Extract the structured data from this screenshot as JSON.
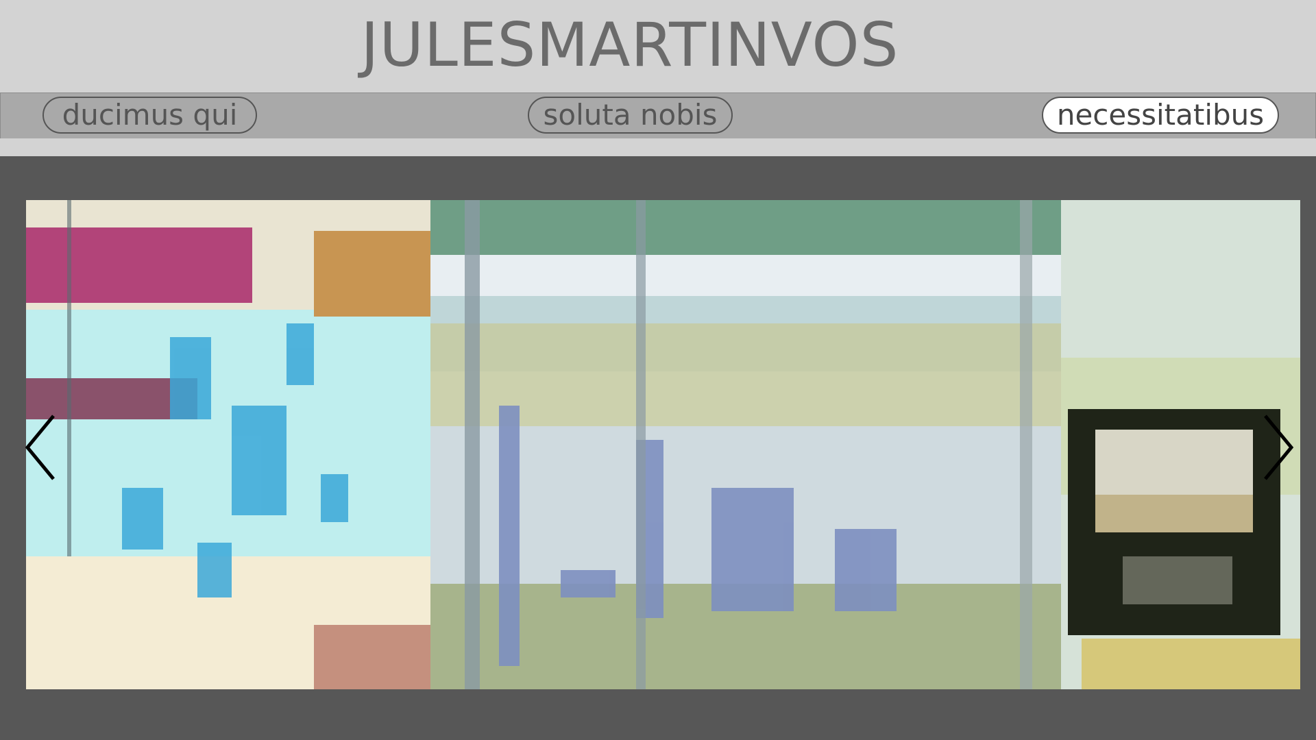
{
  "header": {
    "title": "JULESMARTINVOS"
  },
  "nav": {
    "items": [
      {
        "label": "ducimus qui",
        "active": false
      },
      {
        "label": "soluta nobis",
        "active": false
      },
      {
        "label": "necessitatibus",
        "active": true
      }
    ]
  },
  "carousel": {
    "prev_icon": "chevron-left-icon",
    "next_icon": "chevron-right-icon",
    "image": "slide-photo"
  },
  "colors": {
    "page_bg": "#d3d3d3",
    "navbar_bg": "#a9a9a9",
    "carousel_bg": "#575757",
    "title_text": "#6b6b6b",
    "active_pill_bg": "#ffffff"
  }
}
